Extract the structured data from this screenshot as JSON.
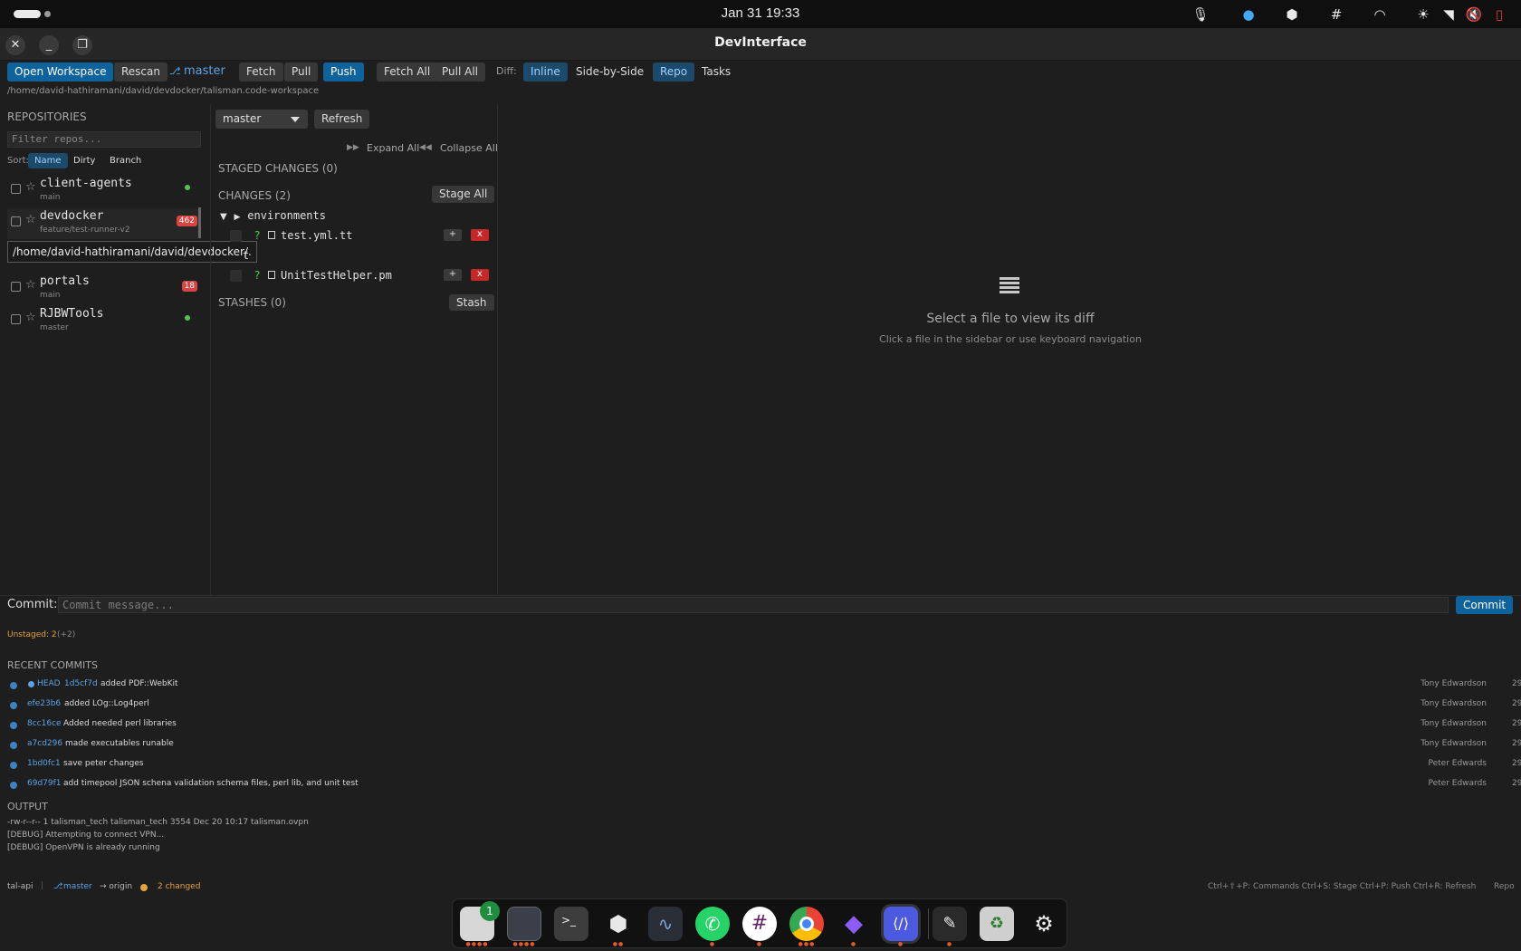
{
  "system": {
    "clock": "Jan 31  19:33"
  },
  "window": {
    "title": "DevInterface"
  },
  "toolbar": {
    "open_workspace": "Open Workspace",
    "rescan": "Rescan",
    "branch": "master",
    "fetch": "Fetch",
    "pull": "Pull",
    "push": "Push",
    "fetch_all": "Fetch All",
    "pull_all": "Pull All",
    "diff_label": "Diff:",
    "inline": "Inline",
    "side_by_side": "Side-by-Side",
    "repo_tab": "Repo",
    "tasks_tab": "Tasks"
  },
  "workspace_path": "/home/david-hathiramani/david/devdocker/talisman.code-workspace",
  "sidebar": {
    "title": "REPOSITORIES",
    "filter_placeholder": "Filter repos...",
    "sort_label": "Sort:",
    "sort_options": [
      "Name",
      "Dirty",
      "Branch"
    ],
    "repos": [
      {
        "name": "client-agents",
        "branch": "main",
        "status": "clean"
      },
      {
        "name": "devdocker",
        "branch": "feature/test-runner-v2",
        "badge": "462"
      },
      {
        "name": "portals",
        "branch": "main",
        "badge": "18"
      },
      {
        "name": "RJBWTools",
        "branch": "master",
        "status": "clean"
      }
    ],
    "tooltip": "/home/david-hathiramani/david/devdocker/."
  },
  "changes_panel": {
    "branch_select": "master",
    "refresh": "Refresh",
    "expand_all": "Expand All",
    "collapse_all": "Collapse All",
    "staged_title": "STAGED CHANGES (0)",
    "changes_title": "CHANGES (2)",
    "stage_all": "Stage All",
    "folder": "environments",
    "folder2": "t",
    "files": [
      {
        "status": "?",
        "name": "test.yml.tt"
      },
      {
        "status": "?",
        "name": "UnitTestHelper.pm"
      }
    ],
    "plus": "+",
    "discard": "x",
    "stashes_title": "STASHES (0)",
    "stash": "Stash"
  },
  "diff_view": {
    "empty_title": "Select a file to view its diff",
    "empty_hint": "Click a file in the sidebar or use keyboard navigation"
  },
  "commit": {
    "label": "Commit:",
    "placeholder": "Commit message...",
    "button": "Commit",
    "unstaged": "Unstaged: 2",
    "unstaged_extra": "(+2)"
  },
  "recent_commits": {
    "title": "RECENT COMMITS",
    "head_label": "HEAD",
    "rows": [
      {
        "hash": "1d5cf7d",
        "message": "added PDF::WebKit",
        "author": "Tony Edwardson",
        "time": "29",
        "head": true
      },
      {
        "hash": "efe23b6",
        "message": "added LOg::Log4perl",
        "author": "Tony Edwardson",
        "time": "29"
      },
      {
        "hash": "8cc16ce",
        "message": "Added needed perl libraries",
        "author": "Tony Edwardson",
        "time": "29"
      },
      {
        "hash": "a7cd296",
        "message": "made executables runable",
        "author": "Tony Edwardson",
        "time": "29"
      },
      {
        "hash": "1bd0fc1",
        "message": "save peter changes",
        "author": "Peter Edwards",
        "time": "29"
      },
      {
        "hash": "69d79f1",
        "message": "add timepool JSON schena validation schema files, perl lib, and unit test",
        "author": "Peter Edwards",
        "time": "29"
      }
    ]
  },
  "output": {
    "title": "OUTPUT",
    "lines": [
      "-rw-r--r-- 1 talisman_tech talisman_tech 3554 Dec 20 10:17 talisman.ovpn",
      "[DEBUG] Attempting to connect VPN...",
      "[DEBUG] OpenVPN is already running"
    ]
  },
  "statusbar": {
    "project": "tal-api",
    "branch": "master",
    "remote": "→ origin",
    "changed": "2 changed",
    "shortcuts": "Ctrl+⇧+P: Commands  Ctrl+S: Stage  Ctrl+P: Push  Ctrl+R: Refresh",
    "mode": "Repo"
  },
  "dock": {
    "files_badge": "1"
  },
  "colors": {
    "accent": "#0e639c",
    "danger": "#c62828",
    "link": "#5aa3e8",
    "clean": "#4ec94e"
  }
}
